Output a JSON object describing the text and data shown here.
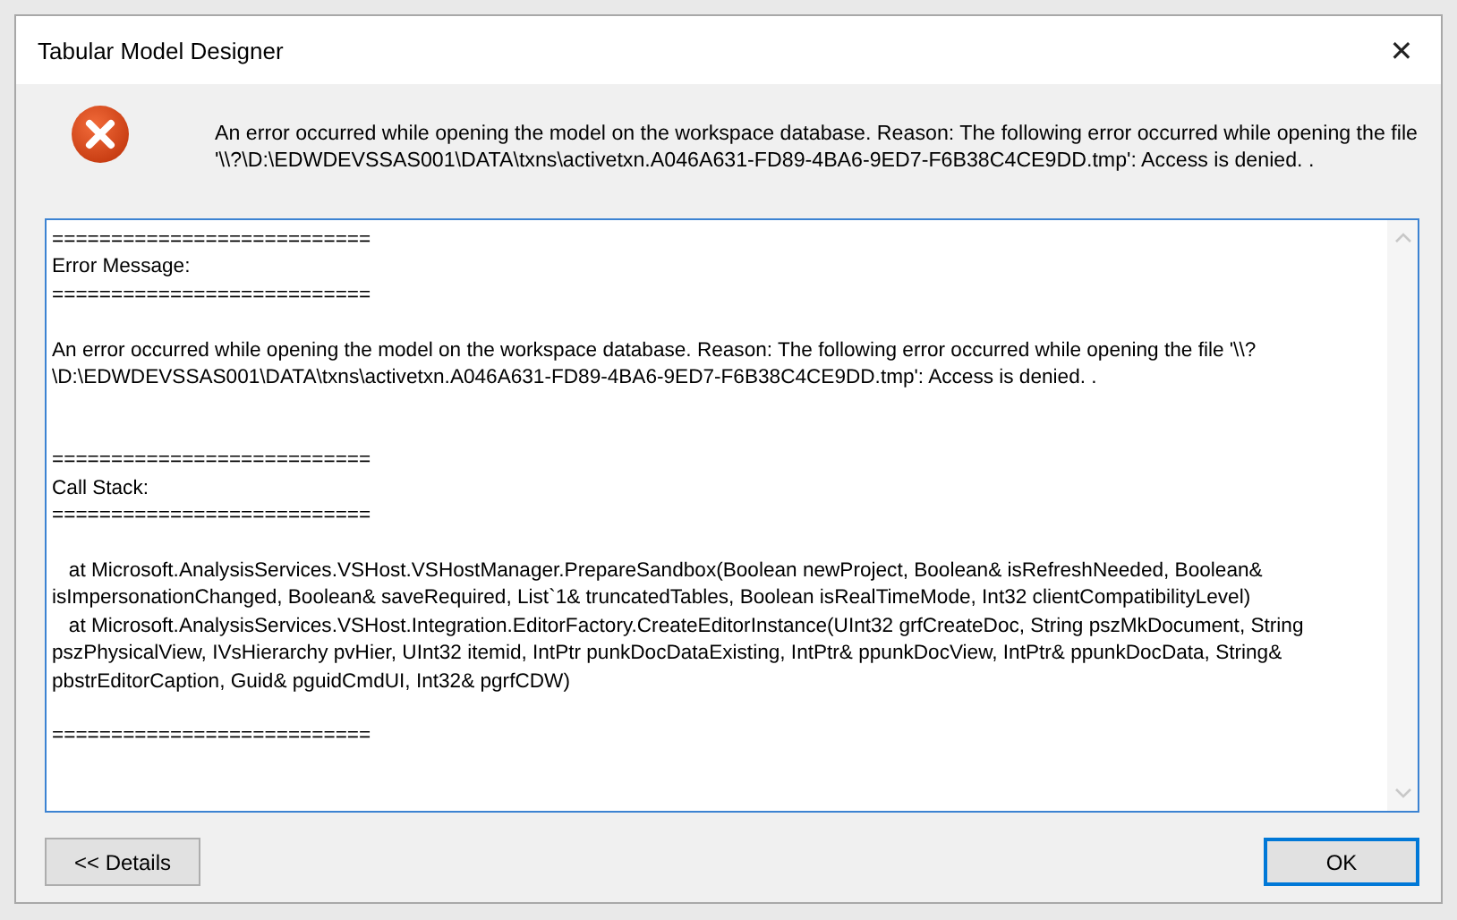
{
  "window": {
    "title": "Tabular Model Designer",
    "close": "✕"
  },
  "message": "An error occurred while opening the model on the workspace database. Reason: The following error occurred while opening the file '\\\\?\\D:\\EDWDEVSSAS001\\DATA\\txns\\activetxn.A046A631-FD89-4BA6-9ED7-F6B38C4CE9DD.tmp': Access is denied. .",
  "details": {
    "value": "===========================\nError Message:\n===========================\n\nAn error occurred while opening the model on the workspace database. Reason: The following error occurred while opening the file '\\\\?\\D:\\EDWDEVSSAS001\\DATA\\txns\\activetxn.A046A631-FD89-4BA6-9ED7-F6B38C4CE9DD.tmp': Access is denied. .\n\n\n===========================\nCall Stack:\n===========================\n\n   at Microsoft.AnalysisServices.VSHost.VSHostManager.PrepareSandbox(Boolean newProject, Boolean& isRefreshNeeded, Boolean& isImpersonationChanged, Boolean& saveRequired, List`1& truncatedTables, Boolean isRealTimeMode, Int32 clientCompatibilityLevel)\n   at Microsoft.AnalysisServices.VSHost.Integration.EditorFactory.CreateEditorInstance(UInt32 grfCreateDoc, String pszMkDocument, String pszPhysicalView, IVsHierarchy pvHier, UInt32 itemid, IntPtr punkDocDataExisting, IntPtr& ppunkDocView, IntPtr& ppunkDocData, String& pbstrEditorCaption, Guid& pguidCmdUI, Int32& pgrfCDW)\n\n===========================",
    "focused": true
  },
  "buttons": [
    {
      "label": "<< Details",
      "default": false
    },
    {
      "label": "OK",
      "default": true
    }
  ]
}
